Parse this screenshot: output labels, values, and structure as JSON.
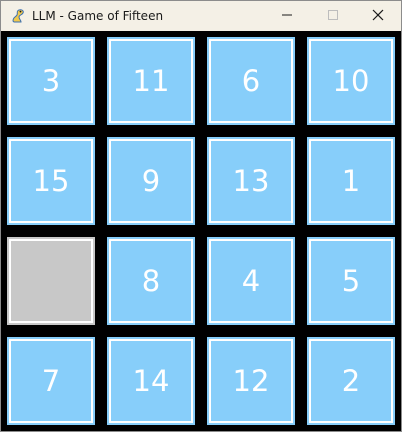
{
  "window": {
    "title": "LLM - Game of Fifteen"
  },
  "colors": {
    "tile": "#87cefa",
    "empty": "#c8c8c8",
    "board_background": "#000000",
    "tile_text": "#ffffff"
  },
  "icons": {
    "app": "pygame-snake-icon",
    "minimize": "minimize-icon",
    "maximize": "maximize-icon",
    "close": "close-icon"
  },
  "board": {
    "rows": 4,
    "columns": 4,
    "tiles": [
      "3",
      "11",
      "6",
      "10",
      "15",
      "9",
      "13",
      "1",
      "",
      "8",
      "4",
      "5",
      "7",
      "14",
      "12",
      "2"
    ],
    "empty_index": 8
  }
}
